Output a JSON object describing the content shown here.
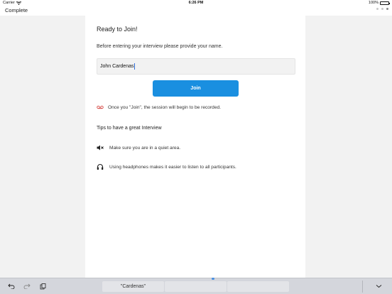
{
  "status_bar": {
    "carrier": "Carrier",
    "time": "6:26 PM",
    "battery": "100%"
  },
  "nav": {
    "back_label": "Complete",
    "page_dots": 3,
    "active_dot": 2
  },
  "main": {
    "heading": "Ready to Join!",
    "instruction": "Before entering your interview please provide your name.",
    "name_value": "John Cardenas",
    "join_label": "Join",
    "recording_notice": "Once you \"Join\", the session will begin to be recorded.",
    "tips_title": "Tips to have a great Interview",
    "tips": [
      {
        "icon": "speaker-muted-icon",
        "text": "Make sure you are in a quiet area."
      },
      {
        "icon": "headphones-icon",
        "text": "Using headphones makes it easier to listen to all participants."
      }
    ]
  },
  "keyboard": {
    "suggestions": [
      "\"Cardenas\"",
      "",
      ""
    ],
    "tools": [
      "undo-icon",
      "redo-icon",
      "paste-icon",
      "dismiss-keyboard-icon"
    ]
  },
  "colors": {
    "accent": "#1a8fe0",
    "recording": "#d0312d",
    "panel": "#f2f2f2",
    "keyboard": "#d4d6dc"
  }
}
